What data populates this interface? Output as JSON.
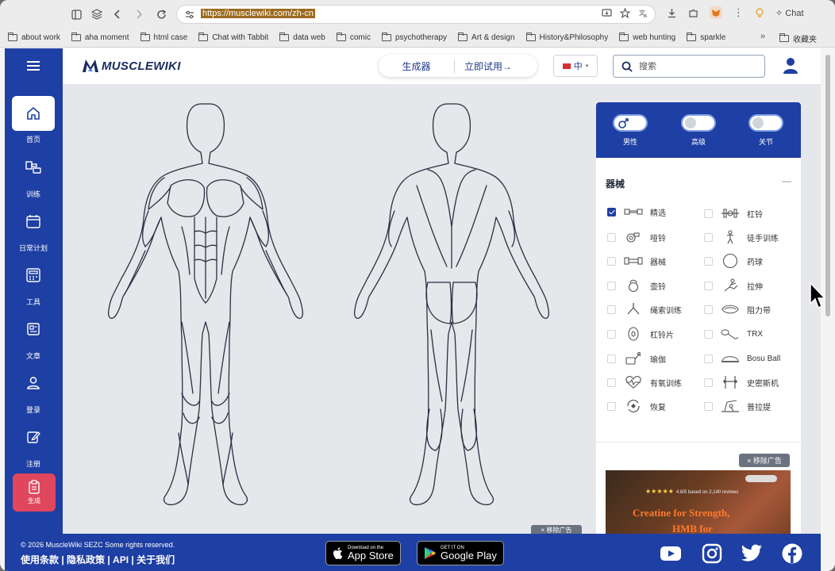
{
  "browser": {
    "url": "https://musclewiki.com/zh-cn",
    "chat_label": "Chat",
    "bookmarks": [
      "about work",
      "aha moment",
      "html case",
      "Chat with Tabbit",
      "data web",
      "comic",
      "psychotherapy",
      "Art & design",
      "History&Philosophy",
      "web hunting",
      "sparkle"
    ],
    "bookmarks_more": "»",
    "bookmarks_last": "收藏夹"
  },
  "header": {
    "logo": "MUSCLEWIKI",
    "generator": "生成器",
    "try_now": "立即试用→",
    "lang": "中",
    "search_placeholder": "搜索"
  },
  "sidebar": {
    "items": [
      {
        "label": "首页",
        "icon": "home-icon"
      },
      {
        "label": "训练",
        "icon": "dumbbell-icon"
      },
      {
        "label": "日常计划",
        "icon": "calendar-icon"
      },
      {
        "label": "工具",
        "icon": "calculator-icon"
      },
      {
        "label": "文章",
        "icon": "article-icon"
      },
      {
        "label": "登录",
        "icon": "user-icon"
      },
      {
        "label": "注册",
        "icon": "edit-icon"
      }
    ],
    "generate": "生成"
  },
  "filters": {
    "toggles": [
      {
        "label": "男性",
        "on": true
      },
      {
        "label": "高级",
        "on": false
      },
      {
        "label": "关节",
        "on": false
      }
    ],
    "equipment_title": "器械",
    "collapse": "—",
    "equipment": [
      {
        "label": "精选",
        "checked": true,
        "icon": "featured-icon"
      },
      {
        "label": "杠铃",
        "checked": false,
        "icon": "barbell-icon"
      },
      {
        "label": "哑铃",
        "checked": false,
        "icon": "dumbbell-icon"
      },
      {
        "label": "徒手训练",
        "checked": false,
        "icon": "bodyweight-icon"
      },
      {
        "label": "器械",
        "checked": false,
        "icon": "machine-icon"
      },
      {
        "label": "药球",
        "checked": false,
        "icon": "medicine-ball-icon"
      },
      {
        "label": "壶铃",
        "checked": false,
        "icon": "kettlebell-icon"
      },
      {
        "label": "拉伸",
        "checked": false,
        "icon": "stretch-icon"
      },
      {
        "label": "绳索训练",
        "checked": false,
        "icon": "cable-icon"
      },
      {
        "label": "阻力带",
        "checked": false,
        "icon": "band-icon"
      },
      {
        "label": "杠铃片",
        "checked": false,
        "icon": "plate-icon"
      },
      {
        "label": "TRX",
        "checked": false,
        "icon": "trx-icon"
      },
      {
        "label": "瑜伽",
        "checked": false,
        "icon": "yoga-icon"
      },
      {
        "label": "Bosu Ball",
        "checked": false,
        "icon": "bosu-icon"
      },
      {
        "label": "有氧训练",
        "checked": false,
        "icon": "cardio-icon"
      },
      {
        "label": "史密斯机",
        "checked": false,
        "icon": "smith-icon"
      },
      {
        "label": "恢复",
        "checked": false,
        "icon": "recovery-icon"
      },
      {
        "label": "普拉提",
        "checked": false,
        "icon": "pilates-icon"
      }
    ]
  },
  "ad": {
    "remove": "× 移除广告",
    "rating": "★★★★★",
    "rating_text": "4.8/5 based on 2,140 reviews",
    "headline1": "Creatine for Strength,",
    "headline2": "HMB for"
  },
  "ad2": {
    "remove": "× 移除广告"
  },
  "footer": {
    "copyright": "© 2026 MuscleWiki SEZC Some rights reserved.",
    "links": "使用条款 | 隐私政策 | API | 关于我们",
    "appstore_small": "Download on the",
    "appstore_big": "App Store",
    "gplay_small": "GET IT ON",
    "gplay_big": "Google Play"
  },
  "colors": {
    "brand": "#1e3fa3",
    "accent": "#e0475c"
  }
}
